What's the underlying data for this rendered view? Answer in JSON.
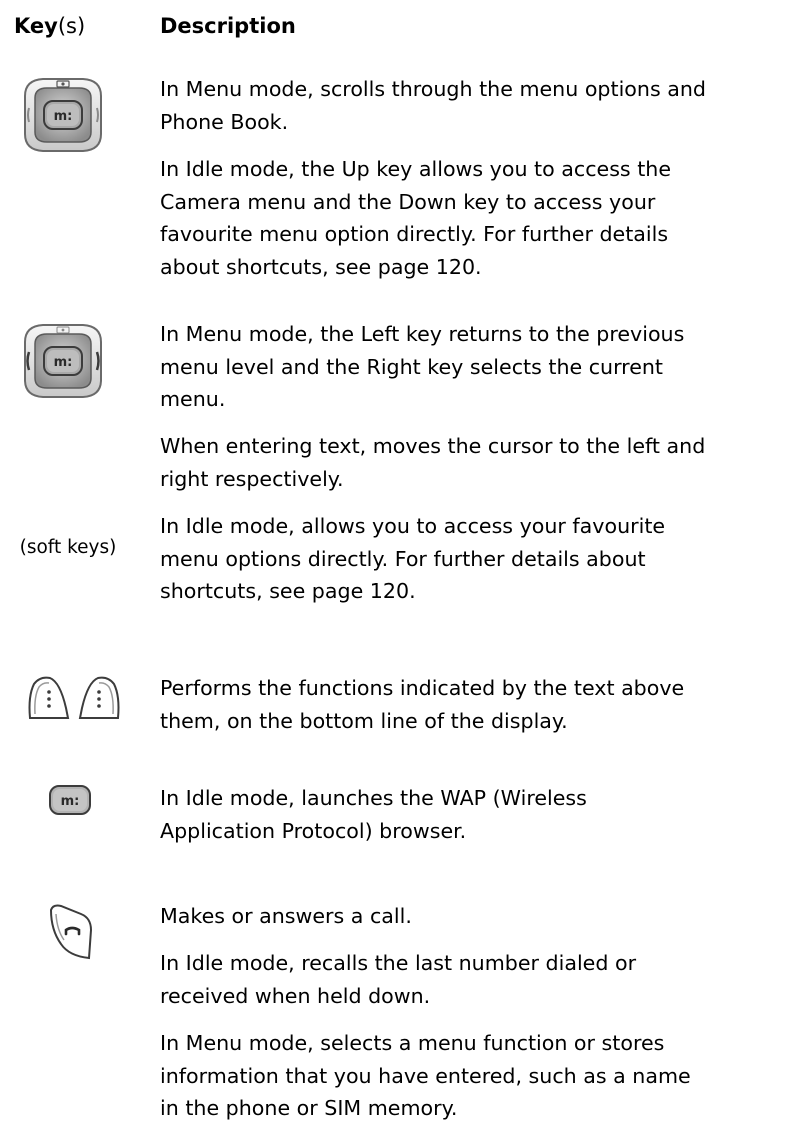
{
  "header": {
    "key_bold": "Key",
    "key_suffix": "(s)",
    "description": "Description"
  },
  "rows": [
    {
      "icon": "navigation-key-up-down-icon",
      "paragraphs": [
        [
          "In Menu mode, scrolls through the menu options and",
          "Phone Book."
        ],
        [
          "In Idle mode, the Up key allows you to access the",
          "Camera menu and the Down key to access your",
          "favourite menu option directly. For further details",
          "about shortcuts, see page 120."
        ]
      ]
    },
    {
      "icon": "navigation-key-left-right-icon",
      "paragraphs": [
        [
          "In Menu mode, the Left key returns to the previous",
          "menu level and the Right key selects the current",
          "menu."
        ],
        [
          "When entering text, moves the cursor to the left and",
          "right respectively."
        ],
        [
          "In Idle mode, allows you to access your favourite",
          "menu options directly. For further details about",
          "shortcuts, see page 120."
        ]
      ]
    },
    {
      "icon": "soft-keys-icon",
      "caption": "(soft keys)",
      "paragraphs": [
        [
          "Performs the functions indicated by the text above",
          "them, on the bottom line of the display."
        ]
      ]
    },
    {
      "icon": "wap-key-icon",
      "paragraphs": [
        [
          "In Idle mode, launches the WAP (Wireless",
          "Application Protocol) browser."
        ]
      ]
    },
    {
      "icon": "send-key-icon",
      "paragraphs": [
        [
          "Makes or answers a call."
        ],
        [
          "In Idle mode, recalls the last number dialed or",
          "received when held down."
        ],
        [
          "In Menu mode, selects a menu function or stores",
          "information that you have entered, such as a name",
          "in the phone or SIM memory."
        ]
      ]
    }
  ]
}
